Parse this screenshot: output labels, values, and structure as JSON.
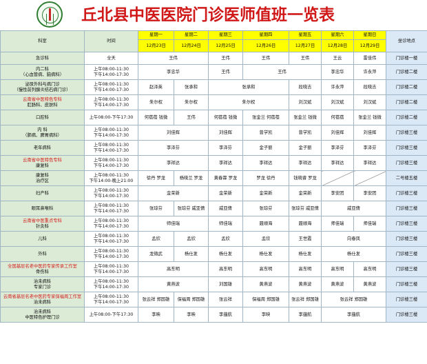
{
  "title": "丘北县中医医院门诊医师值班一览表",
  "header": {
    "dept": "科室",
    "time": "时间",
    "location": "坐诊地点",
    "weekdays": [
      "星期一",
      "星期二",
      "星期三",
      "星期四",
      "星期五",
      "星期六",
      "星期日"
    ],
    "dates": [
      "12月23日",
      "12月24日",
      "12月25日",
      "12月26日",
      "12月27日",
      "12月28日",
      "12月29日"
    ]
  },
  "rows": [
    {
      "dept": [
        "急诊科"
      ],
      "time": [
        "全天"
      ],
      "docs": [
        "王伟",
        "王伟",
        "王伟",
        "王伟",
        "王云",
        "雷佳伟"
      ],
      "loc": "门诊楼一楼"
    },
    {
      "dept": [
        "内二科",
        "（心血管病、脑病科）"
      ],
      "time": [
        "上午08:00-11:30",
        "下午14:00-17:30"
      ],
      "docs": [
        "李忠华",
        "王伟",
        "王伟",
        "李忠华",
        "许永萍"
      ],
      "loc": "门诊楼二楼"
    },
    {
      "dept": [
        "泌尿外科与病门诊",
        "（慢性前列腺炎结石病门诊）"
      ],
      "time": [
        "上午08:00-11:30",
        "下午14:00-17:30"
      ],
      "docs": [
        "赵泽英",
        "张承和",
        "张承和",
        "段晓吉",
        "许永萍",
        "段晓吉"
      ],
      "loc": "门诊楼二楼"
    },
    {
      "dept": [
        "云南省中医特色专科",
        "肛肠科、皮肤科"
      ],
      "red": [
        0
      ],
      "time": [
        "上午08:00-11:30",
        "下午14:00-17:30"
      ],
      "docs": [
        "朱尔权",
        "朱尔权",
        "朱尔权",
        "刘汉斌",
        "刘汉斌",
        "刘汉斌"
      ],
      "loc": "门诊楼二楼"
    },
    {
      "dept": [
        "口腔科"
      ],
      "time": [
        "上午08:00-下午17:30"
      ],
      "docs": [
        "何蓓蓓  钱微",
        "王伟",
        "何蓓蓓  钱微",
        "张金兰  何蓓蓓",
        "张金兰  钱微",
        "何蓓蓓",
        "张金兰  钱微"
      ],
      "loc": "门诊楼二楼"
    },
    {
      "dept": [
        "内  科",
        "（肺病、脾胃病科）"
      ],
      "time": [
        "上午08:00-11:30",
        "下午14:00-17:30"
      ],
      "docs": [
        "刘佳辉",
        "刘佳辉",
        "曾学凯",
        "曾学凯",
        "刘佳辉",
        "刘佳辉"
      ],
      "loc": "门诊楼三楼"
    },
    {
      "dept": [
        "老年病科"
      ],
      "time": [
        "上午08:00-11:30",
        "下午14:00-17:30"
      ],
      "docs": [
        "李泽芬",
        "李泽芬",
        "金子丽",
        "金子丽",
        "李泽芬",
        "李泽芬"
      ],
      "loc": "门诊楼三楼"
    },
    {
      "dept": [
        "云南省中医特色专科",
        "康复科"
      ],
      "red": [
        0
      ],
      "time": [
        "上午08:00-11:30",
        "下午14:00-17:30"
      ],
      "docs": [
        "李祥达",
        "李祥达",
        "李祥达",
        "李祥达",
        "李祥达",
        "李祥达"
      ],
      "loc": "门诊楼三楼"
    },
    {
      "dept": [
        "康复科",
        "治疗区"
      ],
      "time": [
        "上午08:00-11:30",
        "下午14:00-晚上21:00"
      ],
      "docs": [
        "徐丹  罗龙",
        "杨晓兰  罗龙",
        "黄春霖  罗龙",
        "罗龙  徐丹",
        "钱晓睿  罗龙"
      ],
      "loc": "二号楼五楼"
    },
    {
      "dept": [
        "妇产科"
      ],
      "time": [
        "上午08:00-11:30",
        "下午14:00-17:30"
      ],
      "docs": [
        "金荣新",
        "金荣新",
        "金荣新",
        "金荣新",
        "李安团",
        "李安团"
      ],
      "loc": "门诊楼三楼"
    },
    {
      "dept": [
        "眼耳鼻喉科"
      ],
      "time": [
        "上午08:00-11:30",
        "下午14:00-17:30"
      ],
      "docs": [
        "张琼芬",
        "张琼芬  戚亚倩",
        "戚亚倩",
        "张琼芬",
        "张琼芬  戚亚倩",
        "戚亚倩"
      ],
      "loc": "门诊楼三楼"
    },
    {
      "dept": [
        "云南省中医重点专科",
        "针灸科"
      ],
      "red": [
        0
      ],
      "time": [
        "上午08:00-11:30",
        "下午14:00-17:30"
      ],
      "docs": [
        "师佳瑞",
        "师佳瑞",
        "聂顺海",
        "聂顺海",
        "师佳瑞",
        "师佳瑞"
      ],
      "loc": "门诊楼三楼"
    },
    {
      "dept": [
        "儿科"
      ],
      "time": [
        "上午08:00-11:30",
        "下午14:00-17:30"
      ],
      "docs": [
        "孟欣",
        "孟欣",
        "孟欣",
        "孟欣",
        "王世霞",
        "向春凤"
      ],
      "loc": "门诊楼三楼"
    },
    {
      "dept": [
        "外科"
      ],
      "time": [
        "上午08:00-11:30",
        "下午14:00-17:30"
      ],
      "docs": [
        "龙微武",
        "杨仕发",
        "杨仕发",
        "杨仕发",
        "杨仕发",
        "杨仕发"
      ],
      "loc": "门诊楼三楼"
    },
    {
      "dept": [
        "全国基层名老中医药专家传承工作室",
        "骨伤科"
      ],
      "red": [
        0
      ],
      "time": [
        "上午08:00-11:30",
        "下午14:00-17:30"
      ],
      "docs": [
        "高东明",
        "高东明",
        "高东明",
        "高东明",
        "高东明",
        "高东明"
      ],
      "loc": "门诊楼三楼"
    },
    {
      "dept": [
        "治未病科",
        "专家门诊"
      ],
      "time": [
        "上午08:00-11:30",
        "下午14:00-17:30"
      ],
      "docs": [
        "黄燕波",
        "刘国雄",
        "黄燕波",
        "黄燕波",
        "黄燕波",
        "黄燕波"
      ],
      "loc": "门诊楼三楼"
    },
    {
      "dept": [
        "云南省基层名老中医药专家保福周工作室",
        "治未病科"
      ],
      "red": [
        0
      ],
      "time": [
        "上午08:00-11:30",
        "下午14:00-17:30"
      ],
      "docs": [
        "张云祥  郑国雄",
        "保福周  郑国雄",
        "张云祥",
        "保福周  郑国雄",
        "张云祥  郑国雄",
        "张云祥  郑国雄"
      ],
      "loc": "门诊楼三楼"
    },
    {
      "dept": [
        "治未病科",
        "中医特色护理门诊"
      ],
      "time": [
        "上午08:00-下午17:30"
      ],
      "docs": [
        "李映",
        "李映",
        "李蕴航",
        "李映",
        "李蕴航",
        "李蕴航"
      ],
      "loc": "门诊楼三楼"
    }
  ]
}
